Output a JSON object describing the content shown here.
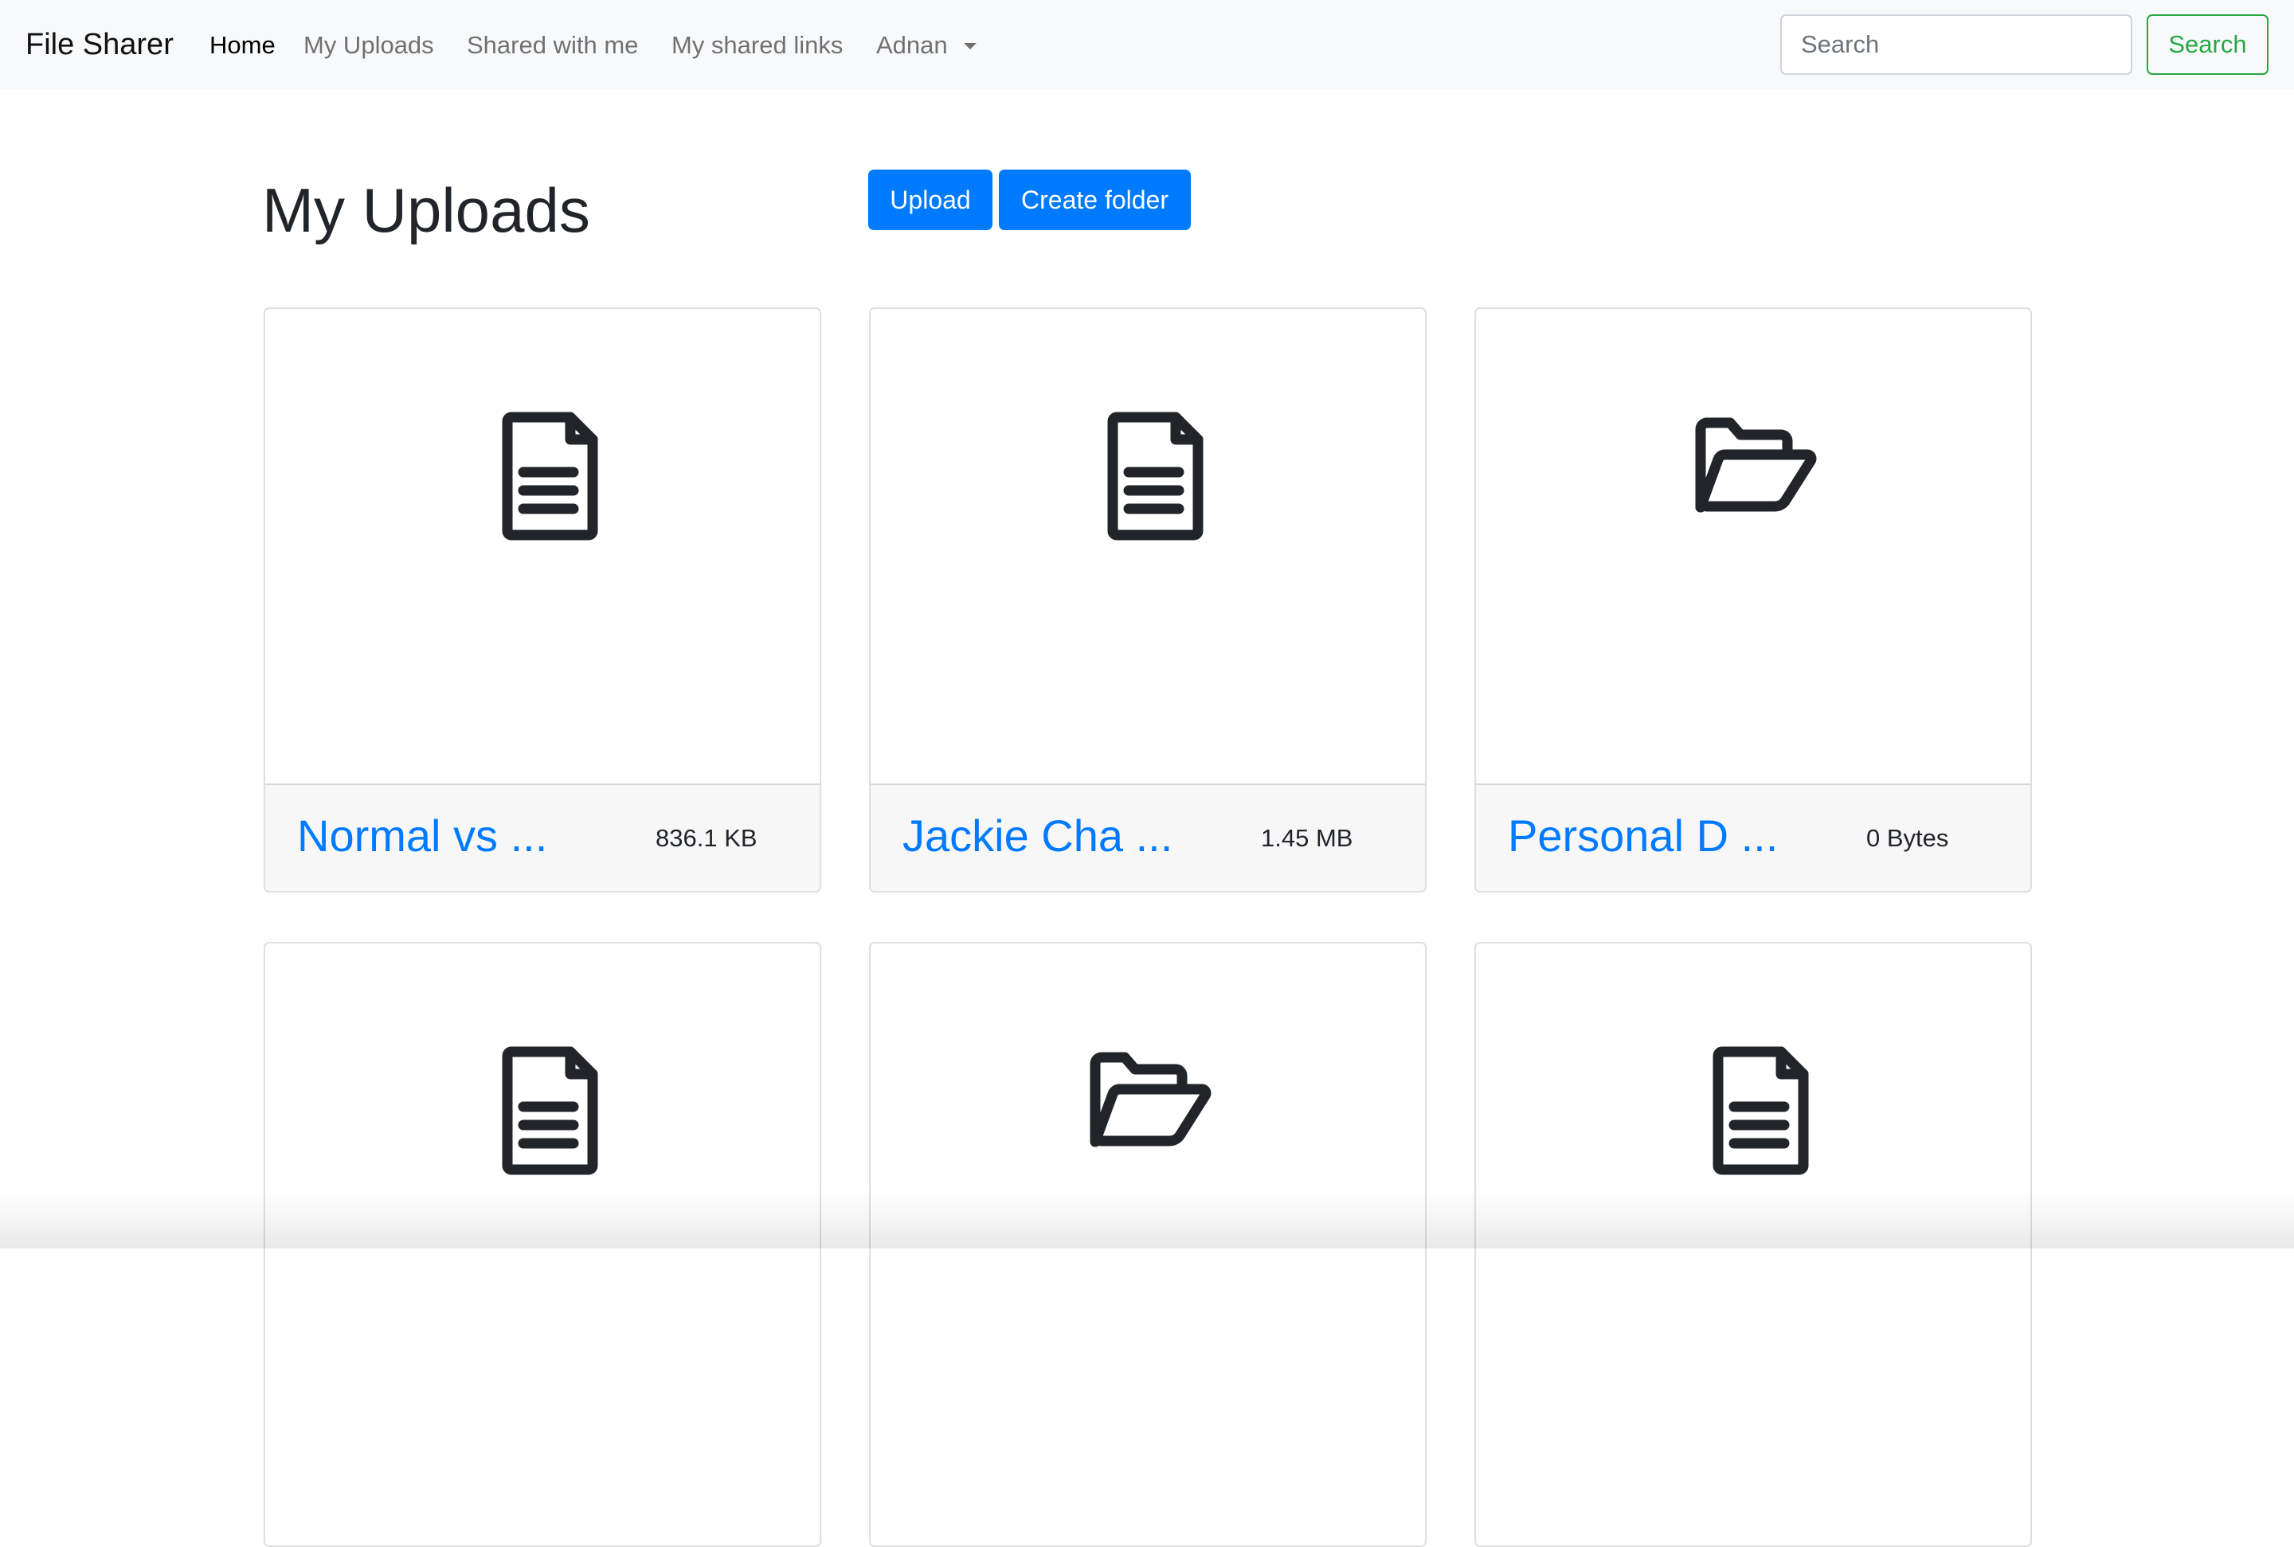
{
  "navbar": {
    "brand": "File Sharer",
    "links": [
      {
        "label": "Home",
        "active": true
      },
      {
        "label": "My Uploads",
        "active": false
      },
      {
        "label": "Shared with me",
        "active": false
      },
      {
        "label": "My shared links",
        "active": false
      },
      {
        "label": "Adnan",
        "active": false,
        "dropdown": true
      }
    ],
    "search": {
      "placeholder": "Search",
      "value": "",
      "button_label": "Search"
    }
  },
  "page": {
    "title": "My Uploads",
    "upload_label": "Upload",
    "create_folder_label": "Create folder"
  },
  "items": [
    {
      "type": "file",
      "icon": "file-text-icon",
      "name": "Normal vs ...",
      "size": "836.1 KB"
    },
    {
      "type": "file",
      "icon": "file-text-icon",
      "name": "Jackie Cha ...",
      "size": "1.45 MB"
    },
    {
      "type": "folder",
      "icon": "folder-open-icon",
      "name": "Personal D ...",
      "size": "0 Bytes"
    },
    {
      "type": "file",
      "icon": "file-text-icon"
    },
    {
      "type": "folder",
      "icon": "folder-open-icon"
    },
    {
      "type": "file",
      "icon": "file-text-icon"
    }
  ],
  "colors": {
    "primary": "#007bff",
    "success": "#28a745",
    "navbar_bg": "#f8f9fa",
    "card_footer_bg": "#f7f7f7",
    "text": "#212529"
  }
}
